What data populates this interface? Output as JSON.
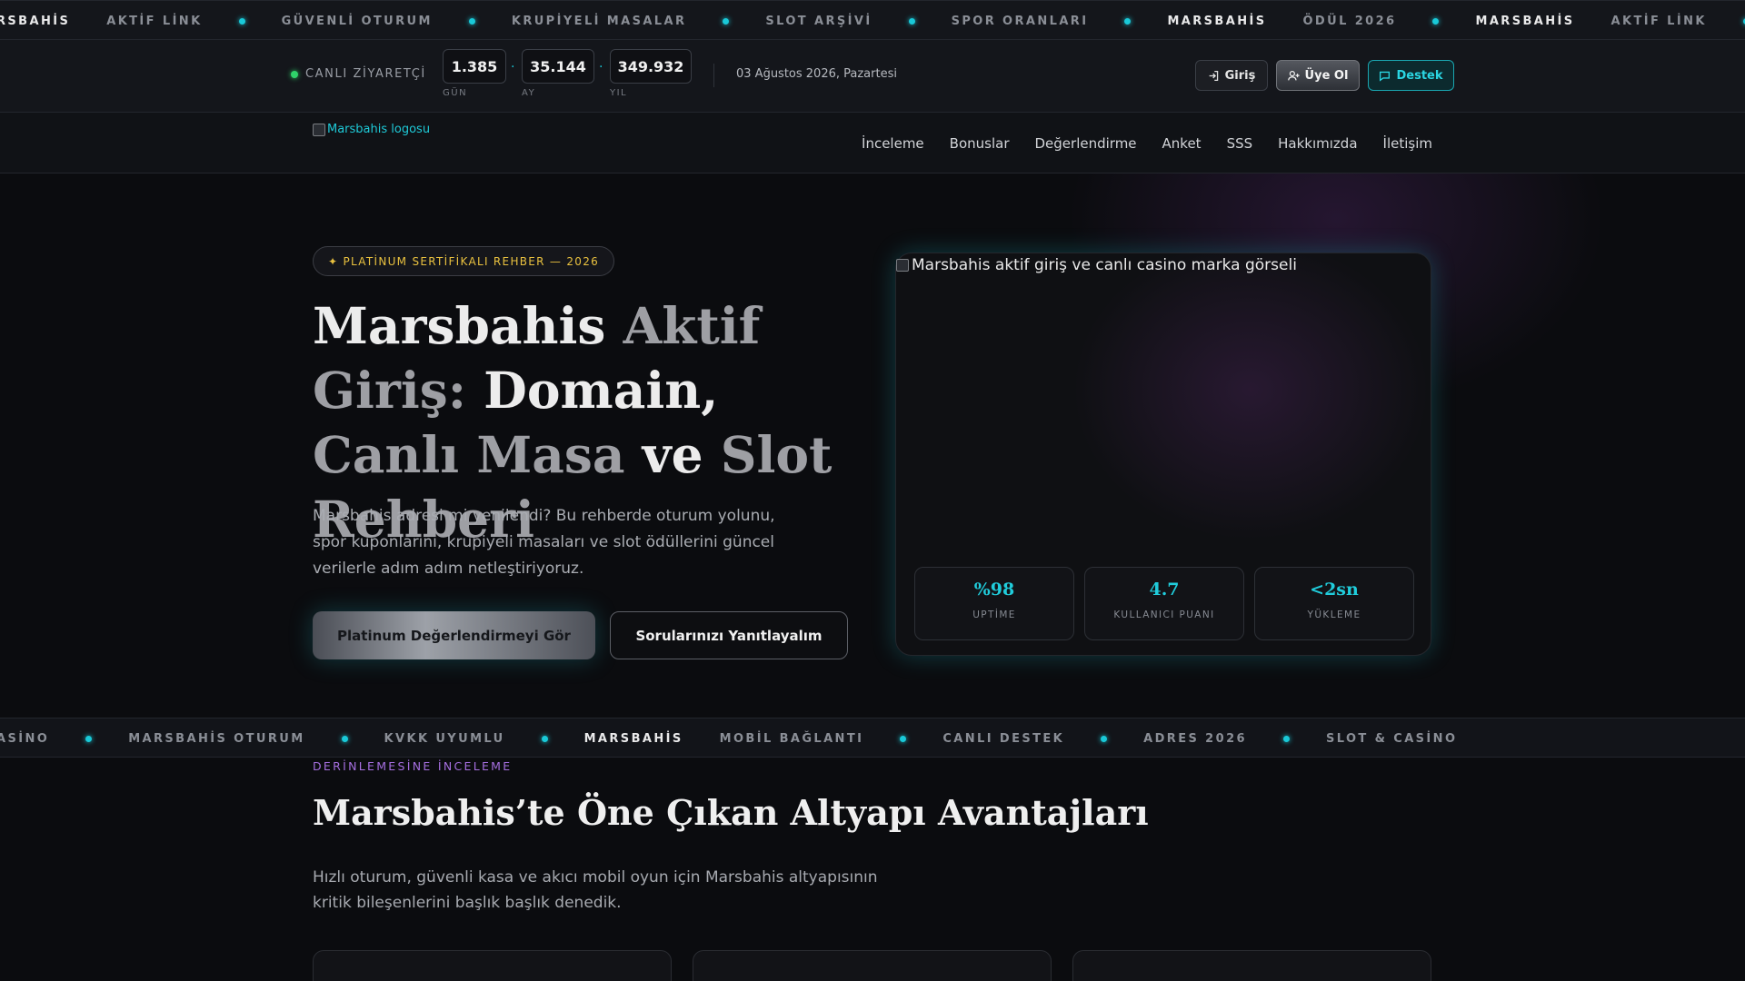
{
  "ticker_top": [
    {
      "text": "RSBAHİS",
      "bright": true
    },
    {
      "text": "AKTİF LİNK",
      "bright": false,
      "dot": true
    },
    {
      "text": "GÜVENLİ OTURUM",
      "bright": false,
      "dot": true
    },
    {
      "text": "KRUPİYELİ MASALAR",
      "bright": false,
      "dot": true
    },
    {
      "text": "SLOT ARŞİVİ",
      "bright": false,
      "dot": true
    },
    {
      "text": "SPOR ORANLARI",
      "bright": false,
      "dot": true
    },
    {
      "text": "MARSBAHİS",
      "bright": true
    },
    {
      "text": "ÖDÜL 2026",
      "bright": false,
      "dot": true
    },
    {
      "text": "MARSBAHİS",
      "bright": true
    },
    {
      "text": "AKTİF LİNK",
      "bright": false,
      "dot": true
    }
  ],
  "status": {
    "live_label": "CANLI ZİYARETÇİ",
    "counters": [
      {
        "value": "1.385",
        "label": "GÜN"
      },
      {
        "value": "35.144",
        "label": "AY"
      },
      {
        "value": "349.932",
        "label": "YIL"
      }
    ],
    "separator": "·",
    "date": "03 Ağustos 2026, Pazartesi",
    "login_label": "Giriş",
    "register_label": "Üye Ol",
    "support_label": "Destek"
  },
  "nav": {
    "logo_alt": "Marsbahis logosu",
    "links": [
      "İnceleme",
      "Bonuslar",
      "Değerlendirme",
      "Anket",
      "SSS",
      "Hakkımızda",
      "İletişim"
    ]
  },
  "hero": {
    "badge": "✦ PLATİNUM SERTİFİKALI REHBER — 2026",
    "title_parts": [
      "Marsbahis ",
      "Aktif Giriş:",
      " Domain, ",
      "Canlı Masa",
      " ve ",
      "Slot Rehberi"
    ],
    "lead": "Marsbahis adresi mi yenilendi? Bu rehberde oturum yolunu, spor kuponlarını, krupiyeli masaları ve slot ödüllerini güncel verilerle adım adım netleştiriyoruz.",
    "cta_primary": "Platinum Değerlendirmeyi Gör",
    "cta_secondary": "Sorularınızı Yanıtlayalım",
    "image_alt": "Marsbahis aktif giriş ve canlı casino marka görseli",
    "stats": [
      {
        "value": "%98",
        "label": "UPTİME"
      },
      {
        "value": "4.7",
        "label": "KULLANICI PUANI"
      },
      {
        "value": "<2sn",
        "label": "YÜKLEME"
      }
    ]
  },
  "ticker_bottom": [
    {
      "text": "ASİNO",
      "bright": false,
      "dot": true
    },
    {
      "text": "MARSBAHİS OTURUM",
      "bright": false,
      "dot": true
    },
    {
      "text": "KVKK UYUMLU",
      "bright": false,
      "dot": true
    },
    {
      "text": "MARSBAHİS",
      "bright": true
    },
    {
      "text": "MOBİL BAĞLANTI",
      "bright": false,
      "dot": true
    },
    {
      "text": "CANLI DESTEK",
      "bright": false,
      "dot": true
    },
    {
      "text": "ADRES 2026",
      "bright": false,
      "dot": true
    },
    {
      "text": "SLOT & CASİNO",
      "bright": false
    }
  ],
  "section": {
    "kicker": "DERİNLEMESİNE İNCELEME",
    "title": "Marsbahis’te Öne Çıkan Altyapı Avantajları",
    "description": "Hızlı oturum, güvenli kasa ve akıcı mobil oyun için Marsbahis altyapısının kritik bileşenlerini başlık başlık denedik."
  },
  "colors": {
    "accent": "#19c9d8",
    "gold": "#e9c13f",
    "purple": "#a66fe0",
    "live": "#2fd36a"
  }
}
